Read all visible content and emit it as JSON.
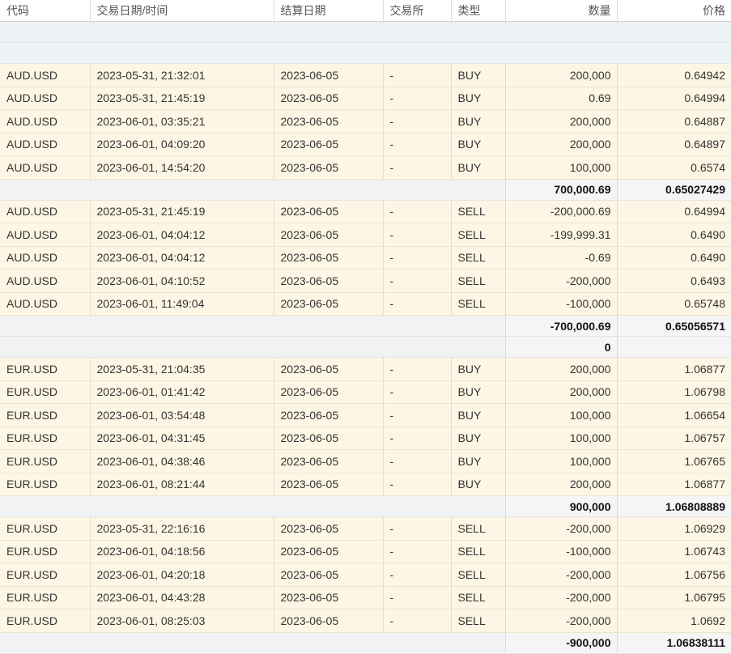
{
  "headers": {
    "symbol": "代码",
    "datetime": "交易日期/时间",
    "settle": "结算日期",
    "exchange": "交易所",
    "type": "类型",
    "quantity": "数量",
    "price": "价格"
  },
  "rows": [
    {
      "kind": "blank"
    },
    {
      "kind": "blank"
    },
    {
      "kind": "trade",
      "symbol": "AUD.USD",
      "datetime": "2023-05-31, 21:32:01",
      "settle": "2023-06-05",
      "exchange": "-",
      "type": "BUY",
      "quantity": "200,000",
      "price": "0.64942"
    },
    {
      "kind": "trade",
      "symbol": "AUD.USD",
      "datetime": "2023-05-31, 21:45:19",
      "settle": "2023-06-05",
      "exchange": "-",
      "type": "BUY",
      "quantity": "0.69",
      "price": "0.64994"
    },
    {
      "kind": "trade",
      "symbol": "AUD.USD",
      "datetime": "2023-06-01, 03:35:21",
      "settle": "2023-06-05",
      "exchange": "-",
      "type": "BUY",
      "quantity": "200,000",
      "price": "0.64887"
    },
    {
      "kind": "trade",
      "symbol": "AUD.USD",
      "datetime": "2023-06-01, 04:09:20",
      "settle": "2023-06-05",
      "exchange": "-",
      "type": "BUY",
      "quantity": "200,000",
      "price": "0.64897"
    },
    {
      "kind": "trade",
      "symbol": "AUD.USD",
      "datetime": "2023-06-01, 14:54:20",
      "settle": "2023-06-05",
      "exchange": "-",
      "type": "BUY",
      "quantity": "100,000",
      "price": "0.6574"
    },
    {
      "kind": "sum",
      "quantity": "700,000.69",
      "price": "0.65027429"
    },
    {
      "kind": "trade",
      "symbol": "AUD.USD",
      "datetime": "2023-05-31, 21:45:19",
      "settle": "2023-06-05",
      "exchange": "-",
      "type": "SELL",
      "quantity": "-200,000.69",
      "price": "0.64994"
    },
    {
      "kind": "trade",
      "symbol": "AUD.USD",
      "datetime": "2023-06-01, 04:04:12",
      "settle": "2023-06-05",
      "exchange": "-",
      "type": "SELL",
      "quantity": "-199,999.31",
      "price": "0.6490"
    },
    {
      "kind": "trade",
      "symbol": "AUD.USD",
      "datetime": "2023-06-01, 04:04:12",
      "settle": "2023-06-05",
      "exchange": "-",
      "type": "SELL",
      "quantity": "-0.69",
      "price": "0.6490"
    },
    {
      "kind": "trade",
      "symbol": "AUD.USD",
      "datetime": "2023-06-01, 04:10:52",
      "settle": "2023-06-05",
      "exchange": "-",
      "type": "SELL",
      "quantity": "-200,000",
      "price": "0.6493"
    },
    {
      "kind": "trade",
      "symbol": "AUD.USD",
      "datetime": "2023-06-01, 11:49:04",
      "settle": "2023-06-05",
      "exchange": "-",
      "type": "SELL",
      "quantity": "-100,000",
      "price": "0.65748"
    },
    {
      "kind": "sum",
      "quantity": "-700,000.69",
      "price": "0.65056571"
    },
    {
      "kind": "sum",
      "quantity": "0",
      "price": ""
    },
    {
      "kind": "trade",
      "symbol": "EUR.USD",
      "datetime": "2023-05-31, 21:04:35",
      "settle": "2023-06-05",
      "exchange": "-",
      "type": "BUY",
      "quantity": "200,000",
      "price": "1.06877"
    },
    {
      "kind": "trade",
      "symbol": "EUR.USD",
      "datetime": "2023-06-01, 01:41:42",
      "settle": "2023-06-05",
      "exchange": "-",
      "type": "BUY",
      "quantity": "200,000",
      "price": "1.06798"
    },
    {
      "kind": "trade",
      "symbol": "EUR.USD",
      "datetime": "2023-06-01, 03:54:48",
      "settle": "2023-06-05",
      "exchange": "-",
      "type": "BUY",
      "quantity": "100,000",
      "price": "1.06654"
    },
    {
      "kind": "trade",
      "symbol": "EUR.USD",
      "datetime": "2023-06-01, 04:31:45",
      "settle": "2023-06-05",
      "exchange": "-",
      "type": "BUY",
      "quantity": "100,000",
      "price": "1.06757"
    },
    {
      "kind": "trade",
      "symbol": "EUR.USD",
      "datetime": "2023-06-01, 04:38:46",
      "settle": "2023-06-05",
      "exchange": "-",
      "type": "BUY",
      "quantity": "100,000",
      "price": "1.06765"
    },
    {
      "kind": "trade",
      "symbol": "EUR.USD",
      "datetime": "2023-06-01, 08:21:44",
      "settle": "2023-06-05",
      "exchange": "-",
      "type": "BUY",
      "quantity": "200,000",
      "price": "1.06877"
    },
    {
      "kind": "sum",
      "quantity": "900,000",
      "price": "1.06808889"
    },
    {
      "kind": "trade",
      "symbol": "EUR.USD",
      "datetime": "2023-05-31, 22:16:16",
      "settle": "2023-06-05",
      "exchange": "-",
      "type": "SELL",
      "quantity": "-200,000",
      "price": "1.06929"
    },
    {
      "kind": "trade",
      "symbol": "EUR.USD",
      "datetime": "2023-06-01, 04:18:56",
      "settle": "2023-06-05",
      "exchange": "-",
      "type": "SELL",
      "quantity": "-100,000",
      "price": "1.06743"
    },
    {
      "kind": "trade",
      "symbol": "EUR.USD",
      "datetime": "2023-06-01, 04:20:18",
      "settle": "2023-06-05",
      "exchange": "-",
      "type": "SELL",
      "quantity": "-200,000",
      "price": "1.06756"
    },
    {
      "kind": "trade",
      "symbol": "EUR.USD",
      "datetime": "2023-06-01, 04:43:28",
      "settle": "2023-06-05",
      "exchange": "-",
      "type": "SELL",
      "quantity": "-200,000",
      "price": "1.06795"
    },
    {
      "kind": "trade",
      "symbol": "EUR.USD",
      "datetime": "2023-06-01, 08:25:03",
      "settle": "2023-06-05",
      "exchange": "-",
      "type": "SELL",
      "quantity": "-200,000",
      "price": "1.0692"
    },
    {
      "kind": "sum",
      "quantity": "-900,000",
      "price": "1.06838111"
    }
  ]
}
